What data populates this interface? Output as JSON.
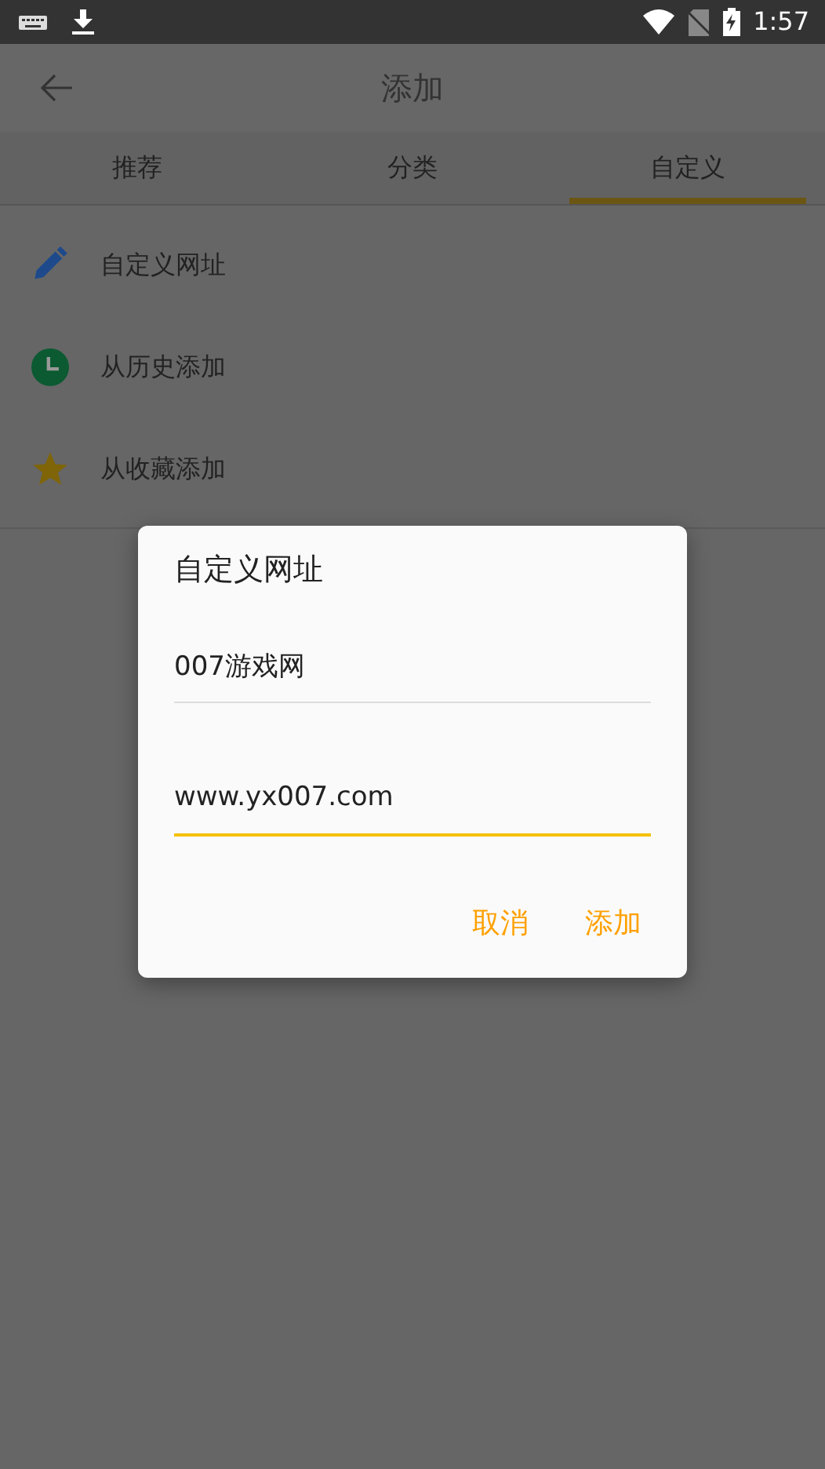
{
  "status_bar": {
    "time": "1:57"
  },
  "app_bar": {
    "title": "添加"
  },
  "tabs": [
    {
      "label": "推荐",
      "selected": false
    },
    {
      "label": "分类",
      "selected": false
    },
    {
      "label": "自定义",
      "selected": true
    }
  ],
  "options": [
    {
      "label": "自定义网址",
      "kind": "pencil",
      "color": "#1e4a8c"
    },
    {
      "label": "从历史添加",
      "kind": "clock",
      "color": "#0b5a32"
    },
    {
      "label": "从收藏添加",
      "kind": "star",
      "color": "#7f6508"
    }
  ],
  "dialog": {
    "title": "自定义网址",
    "fields": [
      {
        "value": "007游戏网",
        "focused": false
      },
      {
        "value": "www.yx007.com",
        "focused": true
      }
    ],
    "buttons": [
      "取消",
      "添加"
    ]
  }
}
